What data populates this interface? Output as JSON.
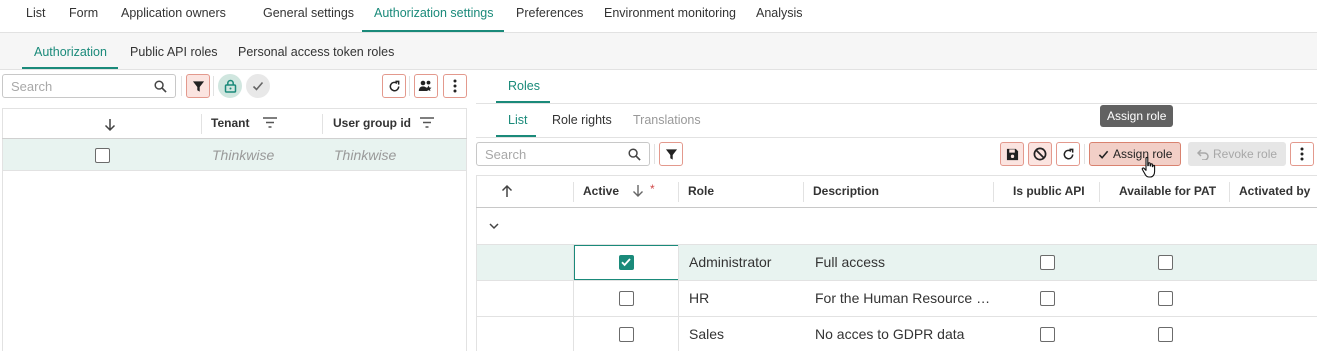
{
  "top_tabs": [
    "List",
    "Form",
    "Application owners",
    "General settings",
    "Authorization settings",
    "Preferences",
    "Environment monitoring",
    "Analysis"
  ],
  "sub_tabs": [
    "Authorization",
    "Public API roles",
    "Personal access token roles"
  ],
  "left_panel": {
    "search_placeholder": "Search",
    "columns": [
      "Tenant",
      "User group id"
    ],
    "row": {
      "tenant": "Thinkwise",
      "user_group_id": "Thinkwise",
      "checked": false
    }
  },
  "right_panel": {
    "title_tab": "Roles",
    "tabs": [
      "List",
      "Role rights",
      "Translations"
    ],
    "search_placeholder": "Search",
    "assign_role_label": "Assign role",
    "revoke_role_label": "Revoke role",
    "tooltip": "Assign role",
    "columns": [
      "Active",
      "Role",
      "Description",
      "Is public API",
      "Available for PAT",
      "Activated by"
    ],
    "required_marker": "*",
    "rows": [
      {
        "active": true,
        "role": "Administrator",
        "description": "Full access",
        "is_public_api": false,
        "available_for_pat": false,
        "selected": true
      },
      {
        "active": false,
        "role": "HR",
        "description": "For the Human Resource …",
        "is_public_api": false,
        "available_for_pat": false,
        "selected": false
      },
      {
        "active": false,
        "role": "Sales",
        "description": "No acces to GDPR data",
        "is_public_api": false,
        "available_for_pat": false,
        "selected": false
      }
    ]
  },
  "colors": {
    "accent": "#1a8a7a",
    "selected_row": "#e8f3f0",
    "button_red_bg": "#fbe4e0",
    "button_red_border": "#e3998d",
    "tooltip_bg": "#616161"
  }
}
